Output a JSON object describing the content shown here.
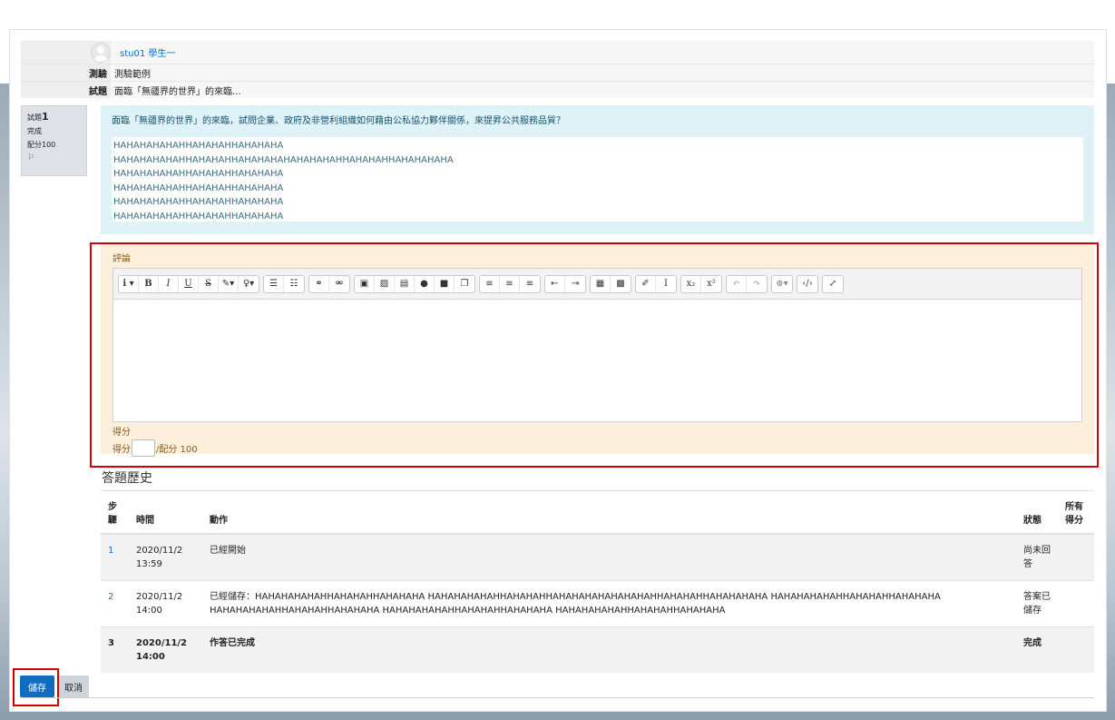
{
  "header": {
    "user_name": "stu01 學生一",
    "quiz_label": "測驗",
    "quiz_value": "測驗範例",
    "question_label": "試題",
    "question_value": "面臨「無疆界的世界」的來臨..."
  },
  "question_info": {
    "qno_prefix": "試題",
    "qno": "1",
    "state": "完成",
    "marks": "配分100",
    "flag_icon": "flag-icon"
  },
  "formulation": {
    "question_text": "面臨「無疆界的世界」的來臨，試問企業、政府及非營利組織如何藉由公私協力夥伴關係，來提昇公共服務品質？",
    "answer_lines": [
      "HAHAHAHAHAHHAHAHAHHAHAHAHA",
      "HAHAHAHAHAHHAHAHAHHAHAHAHAHAHAHAHAHHAHAHAHHAHAHAHAHA",
      "HAHAHAHAHAHHAHAHAHHAHAHAHA",
      "HAHAHAHAHAHHAHAHAHHAHAHAHA",
      "HAHAHAHAHAHHAHAHAHHAHAHAHA",
      "HAHAHAHAHAHHAHAHAHHAHAHAHA"
    ]
  },
  "comment": {
    "label": "評論",
    "grade_label": "得分",
    "grade_prefix": "得分",
    "grade_suffix": "/配分 100",
    "toolbar_icons": [
      "paragraph-style-icon",
      "bold-icon",
      "italic-icon",
      "underline-icon",
      "strikethrough-icon",
      "font-color-icon",
      "background-color-icon",
      "unordered-list-icon",
      "ordered-list-icon",
      "link-icon",
      "unlink-icon",
      "word-paste-icon",
      "image-icon",
      "media-icon",
      "record-audio-icon",
      "record-video-icon",
      "manage-files-icon",
      "align-left-icon",
      "align-center-icon",
      "align-right-icon",
      "outdent-icon",
      "indent-icon",
      "table-icon",
      "equation-icon",
      "clear-formatting-icon",
      "special-char-icon",
      "subscript-icon",
      "superscript-icon",
      "undo-icon",
      "redo-icon",
      "language-icon",
      "html-icon",
      "fullscreen-icon"
    ]
  },
  "history": {
    "title": "答題歷史",
    "headers": {
      "step": "步驟",
      "time": "時間",
      "action": "動作",
      "state": "狀態",
      "marks": "所有得分"
    },
    "rows": [
      {
        "step": "1",
        "time": "2020/11/2 13:59",
        "action": "已經開始",
        "state": "尚未回答"
      },
      {
        "step": "2",
        "time": "2020/11/2 14:00",
        "action": "已經儲存：HAHAHAHAHAHHAHAHAHHAHAHAHA HAHAHAHAHAHHAHAHAHHAHAHAHAHAHAHAHAHHAHAHAHHAHAHAHAHA HAHAHAHAHAHHAHAHAHHAHAHAHA HAHAHAHAHAHHAHAHAHHAHAHAHA HAHAHAHAHAHHAHAHAHHAHAHAHA HAHAHAHAHAHHAHAHAHHAHAHAHA",
        "state": "答案已儲存"
      },
      {
        "step": "3",
        "time": "2020/11/2 14:00",
        "action": "作答已完成",
        "state": "完成"
      }
    ]
  },
  "buttons": {
    "save": "儲存",
    "cancel": "取消"
  }
}
